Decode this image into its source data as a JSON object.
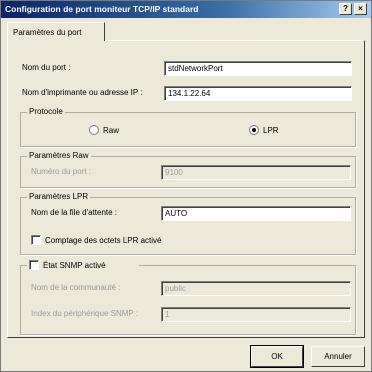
{
  "window": {
    "title": "Configuration de port moniteur TCP/IP standard",
    "help_label": "?",
    "close_label": "×"
  },
  "tab": {
    "label": "Paramètres du port"
  },
  "port": {
    "name_label": "Nom du port :",
    "name_value": "stdNetworkPort",
    "address_label": "Nom d'imprimante ou adresse IP :",
    "address_value": "134.1.22.64"
  },
  "protocol": {
    "legend": "Protocole",
    "raw_label": "Raw",
    "lpr_label": "LPR",
    "selected": "LPR"
  },
  "raw_settings": {
    "legend": "Paramètres Raw",
    "port_number_label": "Numéro du port :",
    "port_number_value": "9100"
  },
  "lpr_settings": {
    "legend": "Paramètres LPR",
    "queue_label": "Nom de la file d'attente :",
    "queue_value": "AUTO",
    "byte_count_label": "Comptage des octets LPR activé",
    "byte_count_checked": false
  },
  "snmp": {
    "label": "État SNMP activé",
    "checked": false,
    "community_label": "Nom de la communauté :",
    "community_value": "public",
    "device_index_label": "Index du périphérique SNMP :",
    "device_index_value": "1"
  },
  "buttons": {
    "ok": "OK",
    "cancel": "Annuler"
  }
}
